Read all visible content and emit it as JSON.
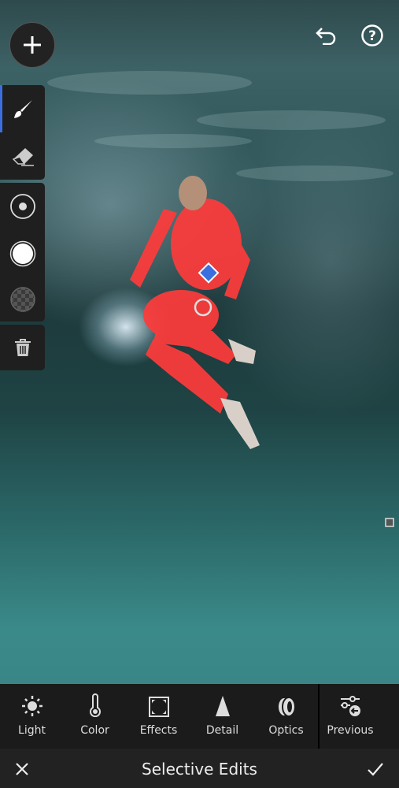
{
  "header": {
    "undo_icon": "undo-icon",
    "help_icon": "help-icon",
    "add_icon": "plus-icon"
  },
  "sidebar": {
    "tools": [
      {
        "name": "brush",
        "icon": "brush-icon",
        "active": true
      },
      {
        "name": "eraser",
        "icon": "eraser-icon"
      },
      {
        "name": "size",
        "icon": "brush-size-icon"
      },
      {
        "name": "feather",
        "icon": "feather-icon"
      },
      {
        "name": "flow",
        "icon": "flow-icon"
      },
      {
        "name": "delete",
        "icon": "trash-icon"
      }
    ]
  },
  "mask": {
    "color": "#ff3b3b"
  },
  "toolbar": {
    "items": [
      {
        "label": "Light",
        "icon": "sun-icon"
      },
      {
        "label": "Color",
        "icon": "thermometer-icon"
      },
      {
        "label": "Effects",
        "icon": "vignette-icon"
      },
      {
        "label": "Detail",
        "icon": "triangle-icon"
      },
      {
        "label": "Optics",
        "icon": "lens-icon"
      },
      {
        "label": "Previous",
        "icon": "sliders-previous-icon"
      }
    ]
  },
  "footer": {
    "title": "Selective Edits",
    "cancel_icon": "close-icon",
    "confirm_icon": "check-icon"
  },
  "colors": {
    "background": "#1e1e1e",
    "accent": "#3b6fe0"
  }
}
